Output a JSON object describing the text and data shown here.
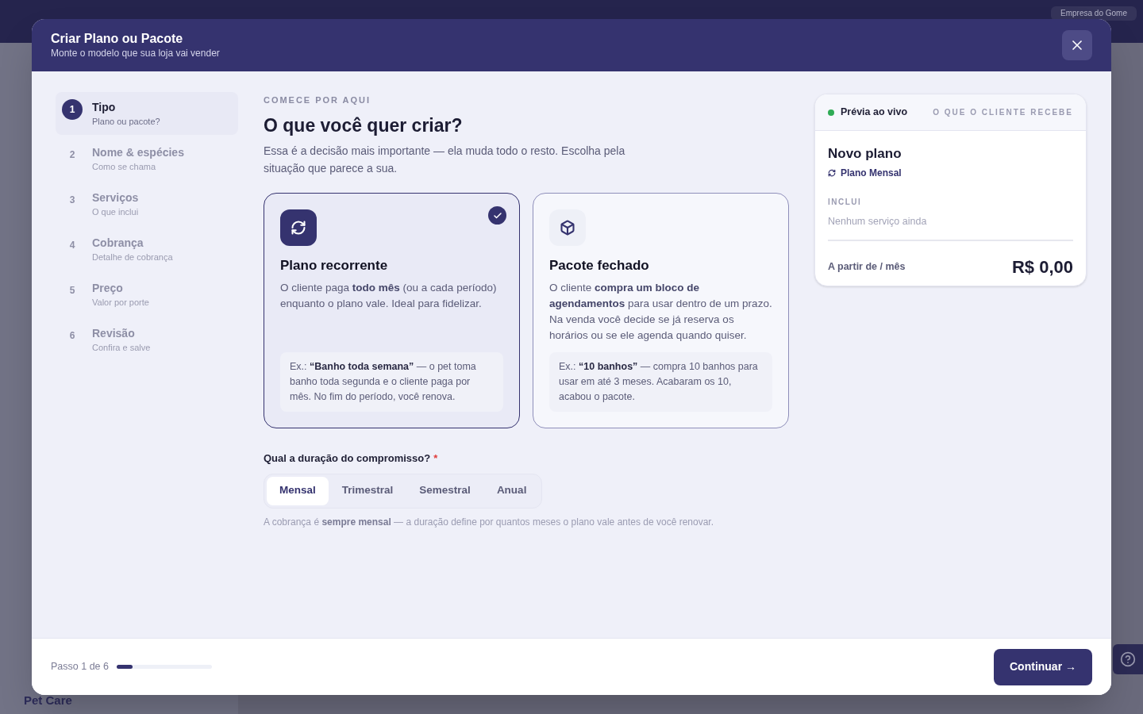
{
  "background": {
    "company": "Empresa do Gome",
    "section": "Pet Care"
  },
  "dialog": {
    "title": "Criar Plano ou Pacote",
    "subtitle": "Monte o modelo que sua loja vai vender"
  },
  "steps": [
    {
      "number": "1",
      "title": "Tipo",
      "subtitle": "Plano ou pacote?",
      "selected": true
    },
    {
      "number": "2",
      "title": "Nome & espécies",
      "subtitle": "Como se chama",
      "selected": false
    },
    {
      "number": "3",
      "title": "Serviços",
      "subtitle": "O que inclui",
      "selected": false
    },
    {
      "number": "4",
      "title": "Cobrança",
      "subtitle": "Detalhe de cobrança",
      "selected": false
    },
    {
      "number": "5",
      "title": "Preço",
      "subtitle": "Valor por porte",
      "selected": false
    },
    {
      "number": "6",
      "title": "Revisão",
      "subtitle": "Confira e salve",
      "selected": false
    }
  ],
  "main": {
    "eyebrow": "COMECE POR AQUI",
    "heading": "O que você quer criar?",
    "intro": "Essa é a decisão mais importante — ela muda todo o resto. Escolha pela situação que parece a sua."
  },
  "options": [
    {
      "kind": "recurring",
      "title": "Plano recorrente",
      "description": "O cliente paga **todo mês** (ou a cada período) enquanto o plano vale. Ideal para fidelizar.",
      "example": "Ex.: **“Banho toda semana”** — o pet toma banho toda segunda e o cliente paga por mês. No fim do período, você renova.",
      "selected": true
    },
    {
      "kind": "package",
      "title": "Pacote fechado",
      "description": "O cliente **compra um bloco de agendamentos** para usar dentro de um prazo. Na venda você decide se já reserva os horários ou se ele agenda quando quiser.",
      "example": "Ex.: **“10 banhos”** — compra 10 banhos para usar em até 3 meses. Acabaram os 10, acabou o pacote.",
      "selected": false
    }
  ],
  "duration": {
    "label": "Qual a duração do compromisso?",
    "required_mark": "*",
    "options": [
      {
        "label": "Mensal",
        "selected": true
      },
      {
        "label": "Trimestral",
        "selected": false
      },
      {
        "label": "Semestral",
        "selected": false
      },
      {
        "label": "Anual",
        "selected": false
      }
    ],
    "hint": "A cobrança é **sempre mensal** — a duração define por quantos meses o plano vale antes de você renovar."
  },
  "preview": {
    "live_label": "Prévia ao vivo",
    "caption": "O QUE O CLIENTE RECEBE",
    "name": "Novo plano",
    "plan_type": "Plano Mensal",
    "includes_label": "INCLUI",
    "includes_empty": "Nenhum serviço ainda",
    "price_label": "A partir de / mês",
    "price": "R$ 0,00"
  },
  "footer": {
    "step_text": "Passo 1 de 6",
    "progress": {
      "level": 0.17
    },
    "continue": "Continuar →"
  }
}
